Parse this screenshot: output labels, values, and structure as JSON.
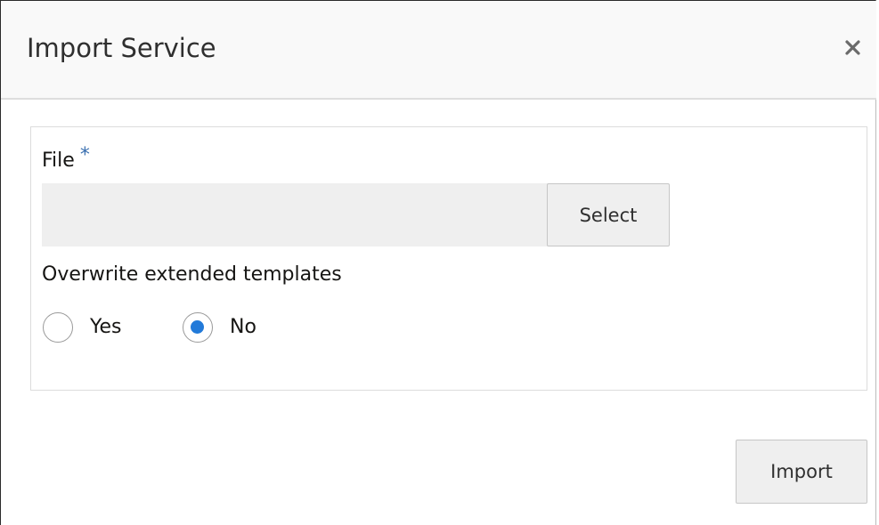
{
  "dialog": {
    "title": "Import Service",
    "close_icon": "close-icon"
  },
  "form": {
    "file_label": "File",
    "required_mark": "*",
    "file_value": "",
    "select_label": "Select",
    "overwrite_label": "Overwrite extended templates",
    "options": [
      {
        "label": "Yes",
        "checked": false
      },
      {
        "label": "No",
        "checked": true
      }
    ]
  },
  "footer": {
    "import_label": "Import"
  },
  "colors": {
    "accent": "#227ad9",
    "required": "#3a6fb0",
    "header_bg": "#f9f9f9",
    "button_bg": "#efefef"
  }
}
